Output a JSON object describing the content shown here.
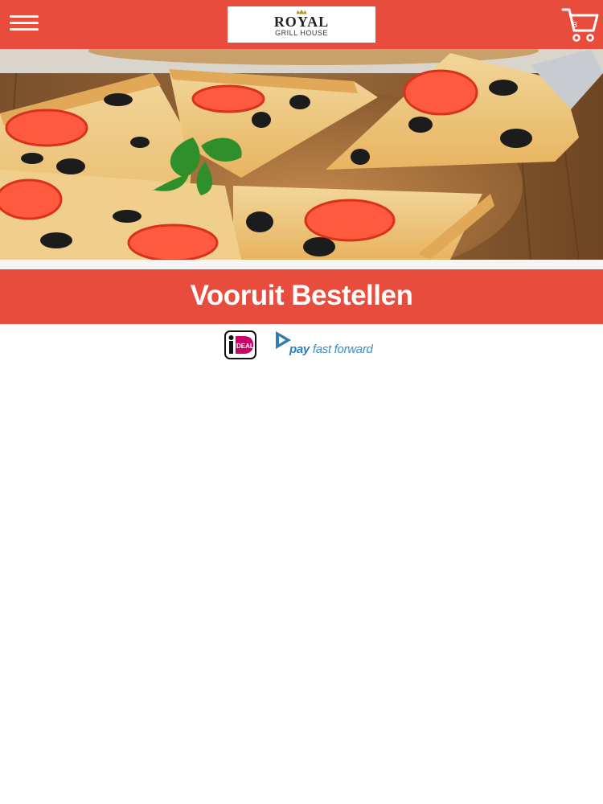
{
  "header": {
    "menu_icon": "hamburger-menu-icon",
    "logo": {
      "title": "ROYAL",
      "subtitle": "GRILL HOUSE"
    },
    "cart": {
      "icon": "shopping-cart-icon",
      "count": "3"
    }
  },
  "hero": {
    "image_subject": "pizza-slices"
  },
  "order": {
    "title": "Vooruit Bestellen"
  },
  "payments": {
    "ideal_label": "iDEAL",
    "pff_pay": "pay",
    "pff_rest": "fast forward"
  },
  "colors": {
    "brand_red": "#e84c3d",
    "white": "#ffffff",
    "ideal_pink": "#cc0066",
    "pff_blue": "#3a8fc8"
  }
}
